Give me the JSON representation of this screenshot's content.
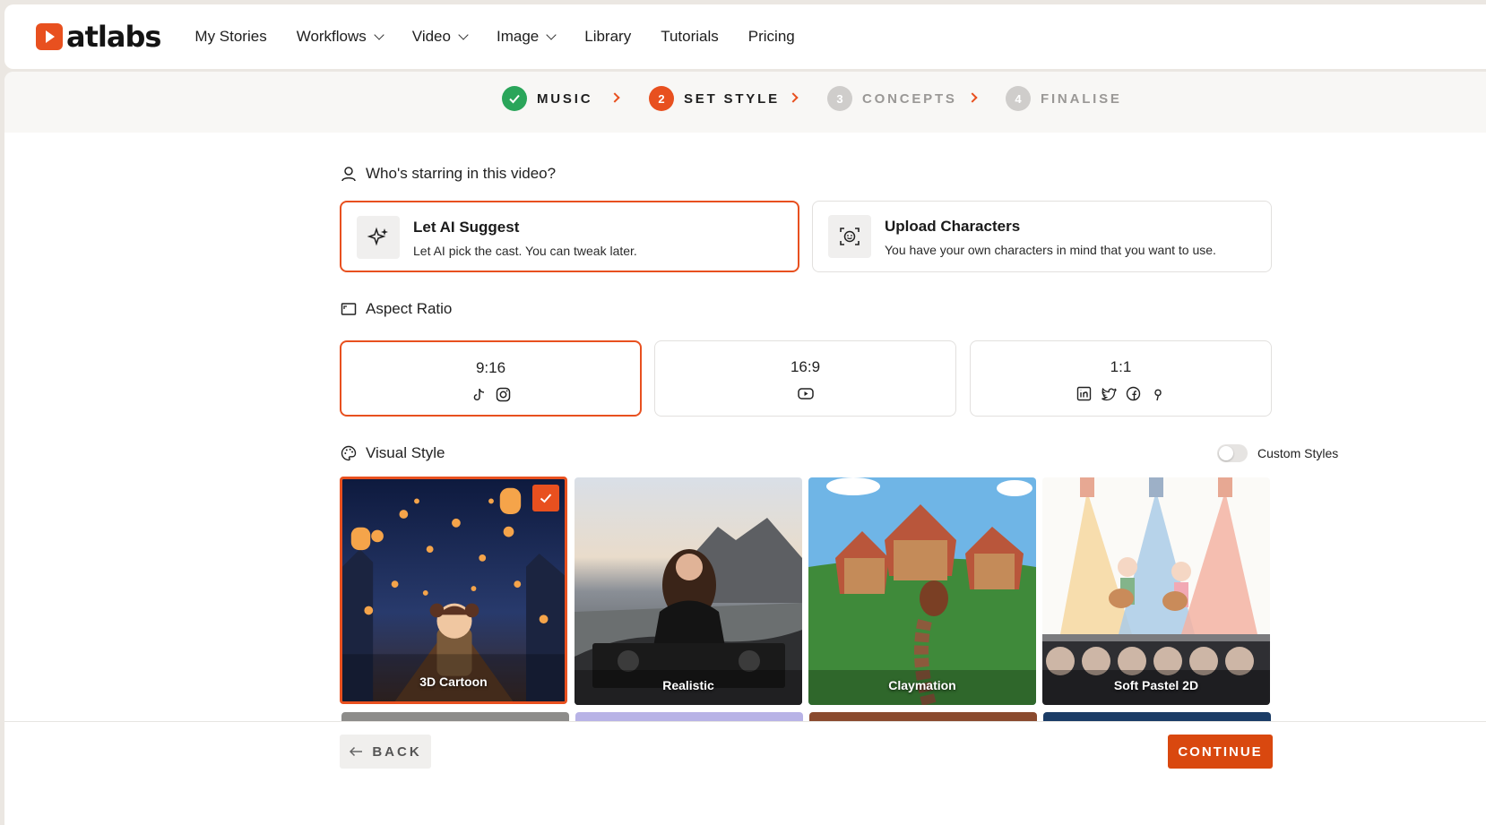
{
  "brand": {
    "name": "atlabs",
    "accent": "#e8501f"
  },
  "nav": {
    "items": [
      {
        "label": "My Stories",
        "has_dropdown": false
      },
      {
        "label": "Workflows",
        "has_dropdown": true
      },
      {
        "label": "Video",
        "has_dropdown": true
      },
      {
        "label": "Image",
        "has_dropdown": true
      },
      {
        "label": "Library",
        "has_dropdown": false
      },
      {
        "label": "Tutorials",
        "has_dropdown": false
      },
      {
        "label": "Pricing",
        "has_dropdown": false
      }
    ]
  },
  "steps": [
    {
      "number": "1",
      "label": "MUSIC",
      "state": "done"
    },
    {
      "number": "2",
      "label": "SET STYLE",
      "state": "current"
    },
    {
      "number": "3",
      "label": "CONCEPTS",
      "state": "pending"
    },
    {
      "number": "4",
      "label": "FINALISE",
      "state": "pending"
    }
  ],
  "cast": {
    "title": "Who's starring in this video?",
    "options": [
      {
        "title": "Let AI Suggest",
        "desc": "Let AI pick the cast. You can tweak later.",
        "icon": "sparkles-icon",
        "selected": true
      },
      {
        "title": "Upload Characters",
        "desc": "You have your own characters in mind that you want to use.",
        "icon": "face-scan-icon",
        "selected": false
      }
    ]
  },
  "aspect": {
    "title": "Aspect Ratio",
    "options": [
      {
        "label": "9:16",
        "icons": [
          "tiktok-icon",
          "instagram-icon"
        ],
        "selected": true
      },
      {
        "label": "16:9",
        "icons": [
          "youtube-icon"
        ],
        "selected": false
      },
      {
        "label": "1:1",
        "icons": [
          "linkedin-icon",
          "twitter-icon",
          "facebook-icon",
          "pinterest-icon"
        ],
        "selected": false
      }
    ]
  },
  "visual": {
    "title": "Visual Style",
    "custom_label": "Custom Styles",
    "custom_enabled": false,
    "styles": [
      {
        "label": "3D Cartoon",
        "selected": true
      },
      {
        "label": "Realistic",
        "selected": false
      },
      {
        "label": "Claymation",
        "selected": false
      },
      {
        "label": "Soft Pastel 2D",
        "selected": false
      }
    ]
  },
  "footer": {
    "back_label": "BACK",
    "continue_label": "CONTINUE"
  }
}
